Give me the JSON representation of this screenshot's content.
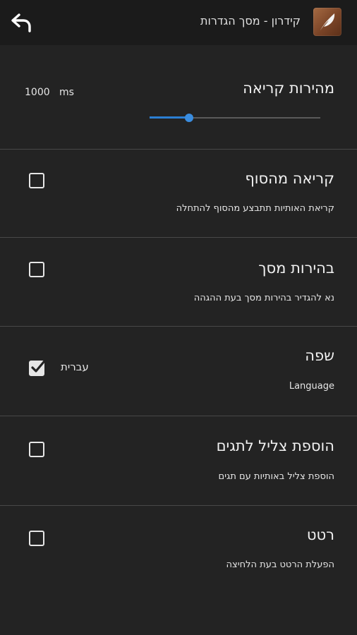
{
  "appbar": {
    "title": "קידרון - מסך הגדרות",
    "back_icon": "back-arrow-icon",
    "app_icon": "quill-feather-icon"
  },
  "reading_speed": {
    "title": "מהירות קריאה",
    "value": "1000",
    "unit": "ms",
    "level": 0.23,
    "accent": "#2b7fd3"
  },
  "settings": [
    {
      "title": "קריאה מהסוף",
      "summary": "קריאת האותיות תתבצע מהסוף להתחלה",
      "checked": false
    },
    {
      "title": "בהירות מסך",
      "summary": "נא להגדיר בהירות מסך בעת ההגהה",
      "checked": false
    },
    {
      "title": "שפה",
      "summary": "Language",
      "value": "עברית",
      "checked": true
    },
    {
      "title": "הוספת צליל לתגים",
      "summary": "הוספת צליל באותיות עם תגים",
      "checked": false
    },
    {
      "title": "רטט",
      "summary": "הפעלת הרטט בעת הלחיצה",
      "checked": false
    }
  ]
}
